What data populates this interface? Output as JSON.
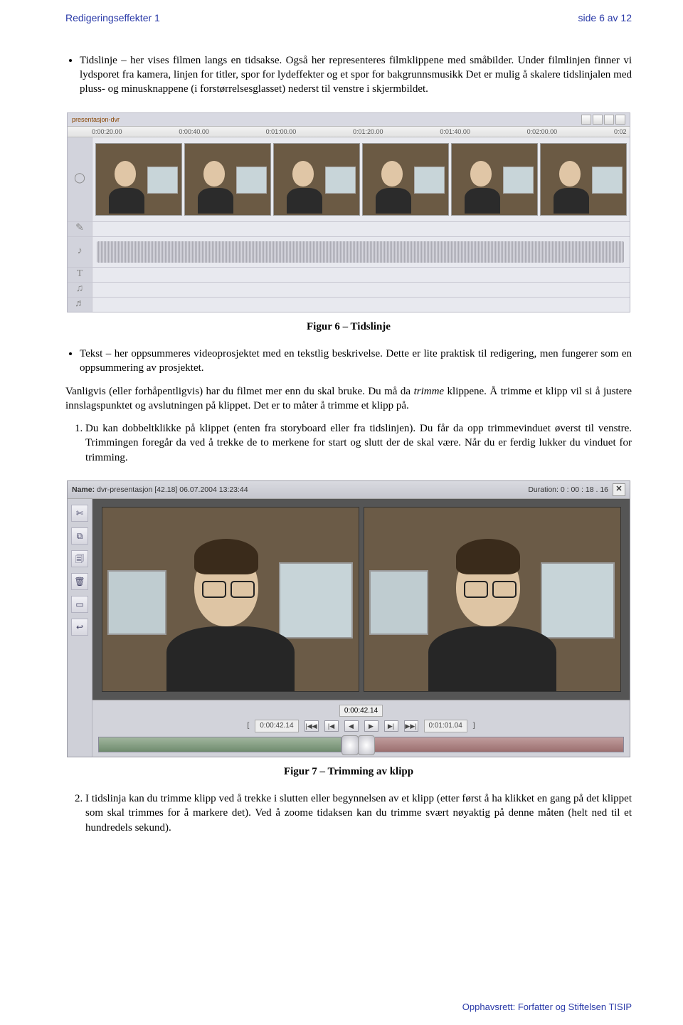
{
  "header": {
    "left": "Redigeringseffekter 1",
    "right": "side 6 av 12"
  },
  "bullets1": [
    "Tidslinje – her vises filmen langs en tidsakse. Også her representeres filmklippene med småbilder. Under filmlinjen finner vi lydsporet fra kamera, linjen for titler, spor for lydeffekter og et spor for bakgrunnsmusikk Det er mulig å skalere tidslinjalen med pluss- og minusknappene (i forstørrelsesglasset) nederst til venstre i skjermbildet."
  ],
  "figure6": {
    "caption": "Figur 6 – Tidslinje",
    "clip_label": "presentasjon-dvr",
    "ruleMarks": [
      "0:00:20.00",
      "0:00:40.00",
      "0:01:00.00",
      "0:01:20.00",
      "0:01:40.00",
      "0:02:00.00",
      "0:02"
    ],
    "gutter_icons": [
      "◯",
      "✎",
      "♪",
      "T",
      "♫",
      "♬"
    ]
  },
  "bullets2": [
    "Tekst – her oppsummeres videoprosjektet med en tekstlig beskrivelse. Dette er lite praktisk til redigering, men fungerer som en oppsummering av prosjektet."
  ],
  "para1_pre": "Vanligvis (eller forhåpentligvis) har du filmet mer enn du skal bruke. Du må da ",
  "para1_em": "trimme",
  "para1_post": " klippene. Å trimme et klipp vil si å justere innslagspunktet og avslutningen på klippet. Det er to måter å trimme et klipp på.",
  "ordered": [
    "Du kan dobbeltklikke på klippet (enten fra storyboard eller fra tidslinjen). Du får da opp trimmevinduet øverst til venstre. Trimmingen foregår da ved å trekke de to merkene for start og slutt der de skal være. Når du er ferdig lukker du vinduet for trimming."
  ],
  "figure7": {
    "caption": "Figur 7 – Trimming av klipp",
    "name_label": "Name:",
    "name_value": "dvr-presentasjon [42.18]  06.07.2004 13:23:44",
    "dur_label": "Duration:",
    "dur_value": "0 : 00 : 18 . 16",
    "tc_center": "0:00:42.14",
    "tc_left": "0:00:42.14",
    "tc_right": "0:01:01.04",
    "transport": [
      "[",
      "|◀◀",
      "|◀",
      "◀",
      "▶",
      "▶|",
      "▶▶|",
      "]"
    ],
    "side_icons": [
      "✄",
      "⧉",
      "🗐",
      "🗑",
      "▭",
      "↩"
    ]
  },
  "ordered2": [
    "I tidslinja kan du trimme klipp ved å trekke i slutten eller begynnelsen av et klipp (etter først å ha klikket en gang på det klippet som skal trimmes for å markere det). Ved å zoome tidaksen kan du trimme svært nøyaktig på denne måten (helt ned til et hundredels sekund)."
  ],
  "footer": "Opphavsrett:  Forfatter og Stiftelsen TISIP"
}
